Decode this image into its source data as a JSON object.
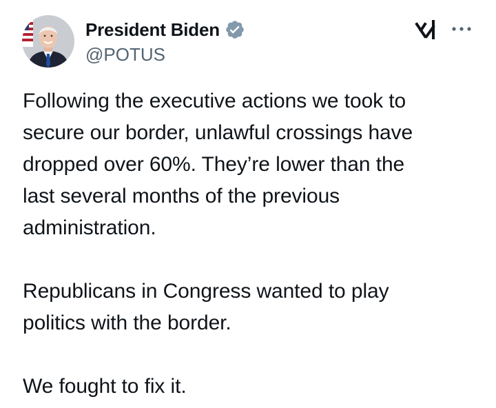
{
  "author": {
    "display_name": "President Biden",
    "handle": "@POTUS",
    "verified": true,
    "verified_badge_color": "#829aab"
  },
  "actions": {
    "grok_icon": "grok-icon",
    "more_icon": "more-dots-icon"
  },
  "tweet": {
    "paragraphs": [
      "Following the executive actions we took to\nsecure our border, unlawful crossings have\ndropped over 60%. They’re lower than the\nlast several months of the previous\nadministration.",
      "Republicans in Congress wanted to play\npolitics with the border.",
      "We fought to fix it."
    ]
  },
  "colors": {
    "text_primary": "#0f1419",
    "text_secondary": "#536471",
    "background": "#ffffff"
  }
}
